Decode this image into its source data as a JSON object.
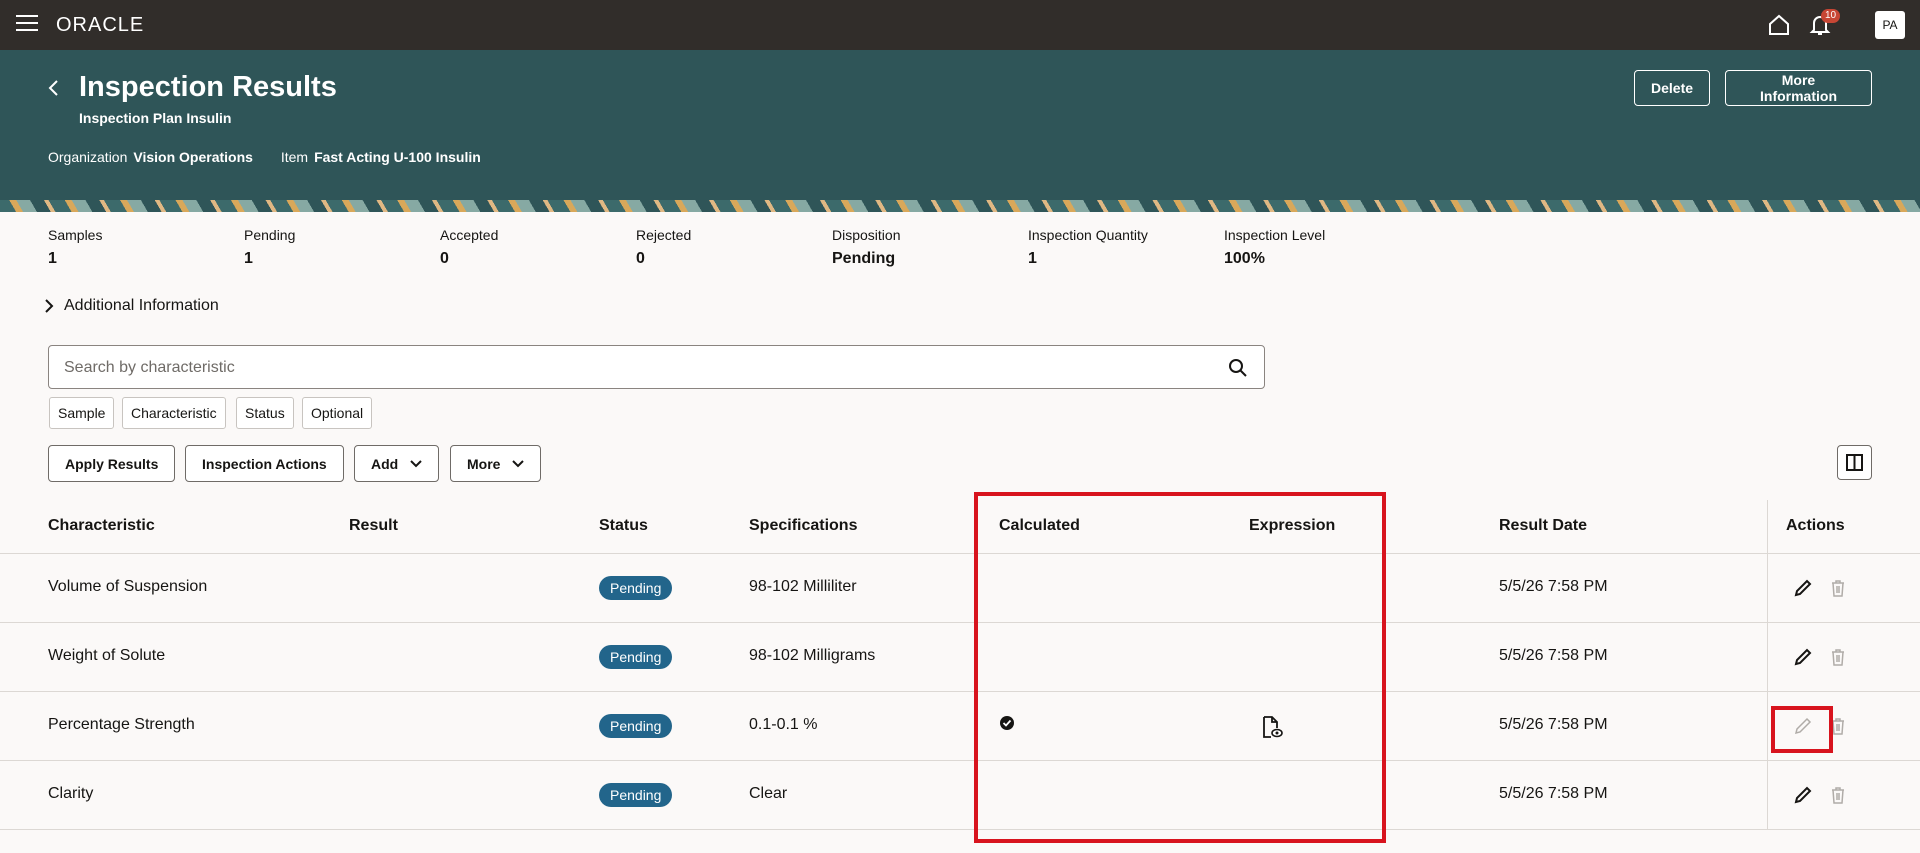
{
  "topbar": {
    "logo": "ORACLE",
    "notification_count": "10",
    "avatar_initials": "PA"
  },
  "header": {
    "title": "Inspection Results",
    "subtitle": "Inspection Plan Insulin",
    "organization_label": "Organization",
    "organization_value": "Vision Operations",
    "item_label": "Item",
    "item_value": "Fast Acting U-100 Insulin",
    "delete_label": "Delete",
    "more_info_label": "More Information"
  },
  "summary": {
    "samples_label": "Samples",
    "samples_value": "1",
    "pending_label": "Pending",
    "pending_value": "1",
    "accepted_label": "Accepted",
    "accepted_value": "0",
    "rejected_label": "Rejected",
    "rejected_value": "0",
    "disposition_label": "Disposition",
    "disposition_value": "Pending",
    "inspection_quantity_label": "Inspection Quantity",
    "inspection_quantity_value": "1",
    "inspection_level_label": "Inspection Level",
    "inspection_level_value": "100%"
  },
  "additional_info_label": "Additional Information",
  "search": {
    "placeholder": "Search by characteristic"
  },
  "filters": [
    "Sample",
    "Characteristic",
    "Status",
    "Optional"
  ],
  "toolbar": {
    "apply_results": "Apply Results",
    "inspection_actions": "Inspection Actions",
    "add": "Add",
    "more": "More"
  },
  "table": {
    "columns": {
      "characteristic": "Characteristic",
      "result": "Result",
      "status": "Status",
      "specifications": "Specifications",
      "calculated": "Calculated",
      "expression": "Expression",
      "result_date": "Result Date",
      "actions": "Actions"
    },
    "rows": [
      {
        "characteristic": "Volume of Suspension",
        "result": "",
        "status": "Pending",
        "specifications": "98-102 Milliliter",
        "calculated": false,
        "expression": false,
        "result_date": "5/5/26 7:58 PM",
        "edit_enabled": true
      },
      {
        "characteristic": "Weight of Solute",
        "result": "",
        "status": "Pending",
        "specifications": "98-102 Milligrams",
        "calculated": false,
        "expression": false,
        "result_date": "5/5/26 7:58 PM",
        "edit_enabled": true
      },
      {
        "characteristic": "Percentage Strength",
        "result": "",
        "status": "Pending",
        "specifications": "0.1-0.1 %",
        "calculated": true,
        "expression": true,
        "result_date": "5/5/26 7:58 PM",
        "edit_enabled": false
      },
      {
        "characteristic": "Clarity",
        "result": "",
        "status": "Pending",
        "specifications": "Clear",
        "calculated": false,
        "expression": false,
        "result_date": "5/5/26 7:58 PM",
        "edit_enabled": true
      }
    ]
  },
  "colors": {
    "header_bg": "#2f5558",
    "topbar_bg": "#312d2a",
    "status_pill": "#22658b",
    "highlight_box": "#d8141e",
    "badge": "#c74634"
  }
}
